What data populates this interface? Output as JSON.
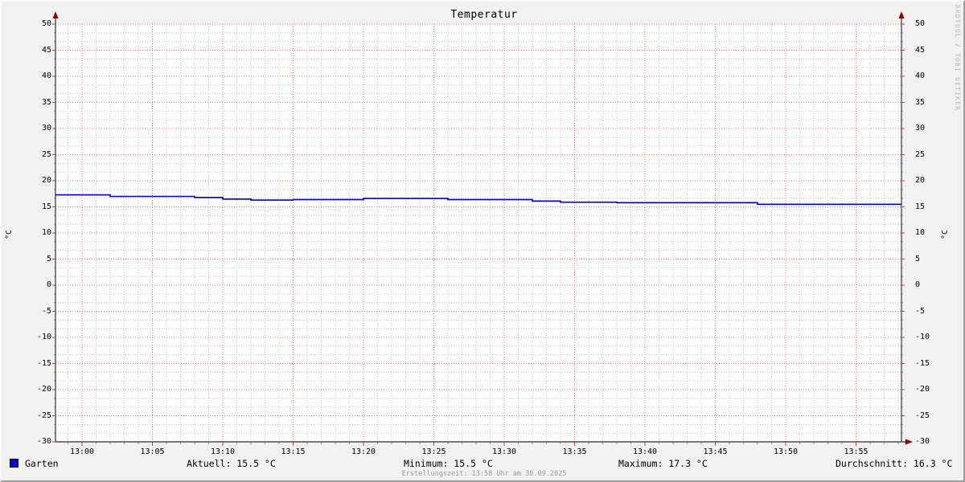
{
  "title": "Temperatur",
  "watermark": "RRDTOOL / TOBI OETIKER",
  "footer": "Erstellungszeit: 13:58 Uhr am 30.09.2025",
  "y_axis": {
    "unit": "°C",
    "ticks": [
      50,
      45,
      40,
      35,
      30,
      25,
      20,
      15,
      10,
      5,
      0,
      -5,
      -10,
      -15,
      -20,
      -25,
      -30
    ]
  },
  "x_axis": {
    "ticks": [
      "13:00",
      "13:05",
      "13:10",
      "13:15",
      "13:20",
      "13:25",
      "13:30",
      "13:35",
      "13:40",
      "13:45",
      "13:50",
      "13:55"
    ]
  },
  "legend": {
    "series_label": "Garten",
    "aktuell": "Aktuell: 15.5 °C",
    "minimum": "Minimum: 15.5 °C",
    "maximum": "Maximum: 17.3 °C",
    "durchschnitt": "Durchschnitt: 16.3 °C"
  },
  "colors": {
    "line": "#0000c8",
    "legend_swatch": "#0000cc",
    "grid_major": "#ec8181",
    "grid_minor": "#c9c9c9",
    "axis": "#4d4d4d",
    "arrow": "#8b0000",
    "tick_major": "#c04040",
    "tick_minor": "#999999",
    "background": "#f1f1f1",
    "canvas": "#fdfdfd"
  },
  "chart_data": {
    "type": "line",
    "title": "Temperatur",
    "ylabel": "°C",
    "ylim": [
      -30,
      50
    ],
    "x_window": "12:58 - 13:58",
    "x_tick_minutes": [
      0,
      5,
      10,
      15,
      20,
      25,
      30,
      35,
      40,
      45,
      50,
      55
    ],
    "x_start_min": -1.9,
    "x_end_min": 58.2,
    "grid": "dotted, minor gray / major red",
    "legend_position": "bottom",
    "series": [
      {
        "name": "Garten",
        "color": "#0000c8",
        "style": "step-after",
        "points_min_degC": [
          [
            -1.9,
            17.3
          ],
          [
            2.0,
            17.0
          ],
          [
            8.0,
            16.8
          ],
          [
            10.0,
            16.5
          ],
          [
            12.0,
            16.3
          ],
          [
            15.0,
            16.4
          ],
          [
            20.0,
            16.6
          ],
          [
            26.0,
            16.4
          ],
          [
            32.0,
            16.1
          ],
          [
            34.0,
            15.9
          ],
          [
            38.0,
            15.8
          ],
          [
            48.0,
            15.5
          ],
          [
            58.2,
            15.5
          ]
        ]
      }
    ],
    "stats": {
      "aktuell": 15.5,
      "minimum": 15.5,
      "maximum": 17.3,
      "durchschnitt": 16.3,
      "unit": "°C"
    }
  }
}
